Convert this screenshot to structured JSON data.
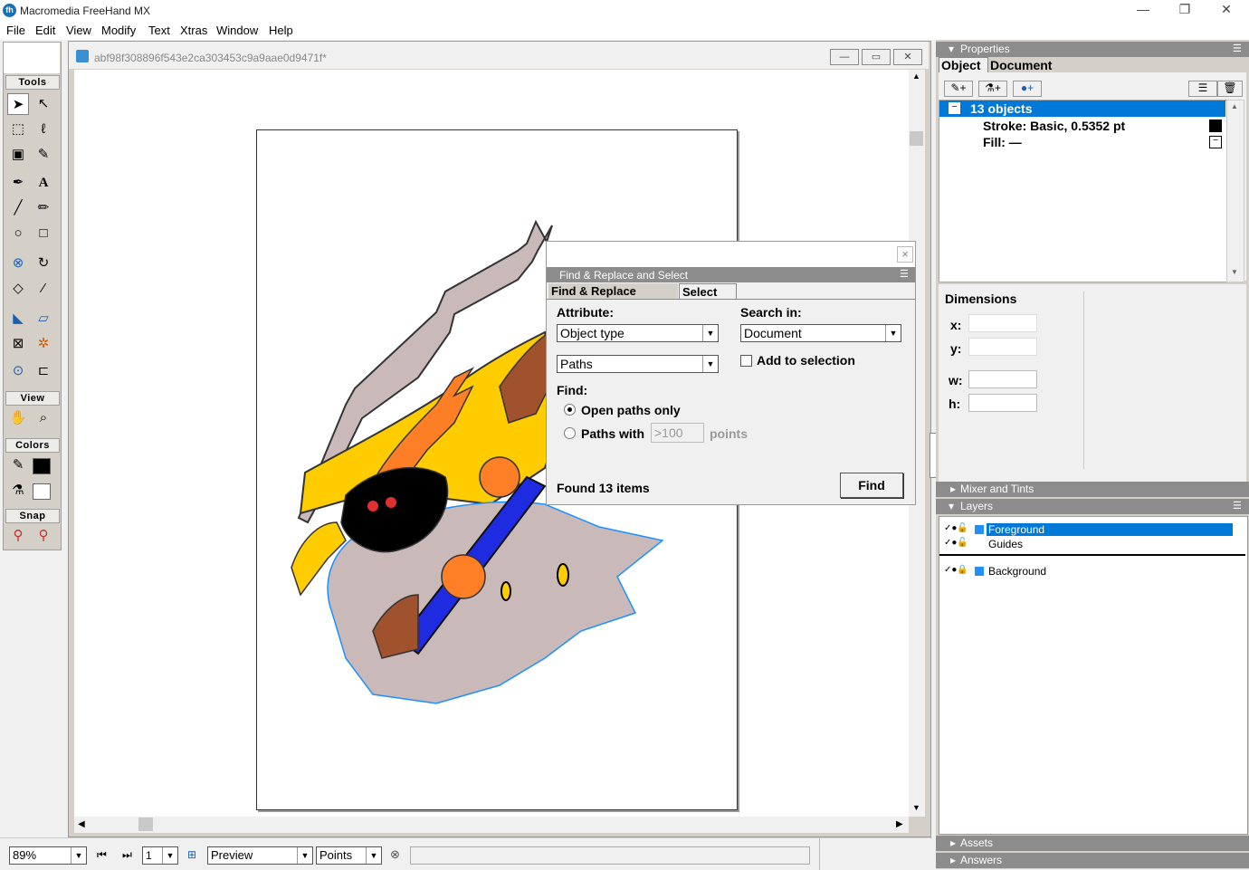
{
  "app": {
    "title": "Macromedia FreeHand MX",
    "logo_text": "fh",
    "window_buttons": [
      "—",
      "❐",
      "✕"
    ]
  },
  "menu": [
    "File",
    "Edit",
    "View",
    "Modify",
    "Text",
    "Xtras",
    "Window",
    "Help"
  ],
  "toolbox": {
    "tools_label": "Tools",
    "view_label": "View",
    "colors_label": "Colors",
    "snap_label": "Snap"
  },
  "document": {
    "title": "abf98f308896f543e2ca303453c9a9aae0d9471f*",
    "buttons": [
      "—",
      "▭",
      "✕"
    ]
  },
  "find_panel": {
    "header": "Find & Replace and Select",
    "tabs": [
      "Find & Replace",
      "Select"
    ],
    "attribute_label": "Attribute:",
    "attribute_value": "Object type",
    "type_value": "Paths",
    "search_in_label": "Search in:",
    "search_in_value": "Document",
    "add_to_selection": "Add to selection",
    "find_label": "Find:",
    "open_paths": "Open paths only",
    "paths_with": "Paths with",
    "paths_with_value": ">100",
    "points_label": "points",
    "found_text": "Found 13 items",
    "find_button": "Find",
    "close": "×"
  },
  "properties": {
    "header": "Properties",
    "tabs": [
      "Object",
      "Document"
    ],
    "selected_item": "13 objects",
    "stroke": "Stroke: Basic, 0.5352 pt",
    "fill": "Fill: —",
    "dimensions_label": "Dimensions",
    "x_label": "x:",
    "y_label": "y:",
    "w_label": "w:",
    "h_label": "h:"
  },
  "mixer": {
    "header": "Mixer and Tints"
  },
  "layers": {
    "header": "Layers",
    "items": [
      "Foreground",
      "Guides",
      "Background"
    ]
  },
  "assets": {
    "header": "Assets"
  },
  "answers": {
    "header": "Answers"
  },
  "status": {
    "zoom": "89%",
    "page": "1",
    "mode": "Preview",
    "units": "Points"
  },
  "colors": {
    "highlight": "#0078d7",
    "panel_head": "#8c8c8c",
    "layer_blue": "#1e90ff"
  }
}
